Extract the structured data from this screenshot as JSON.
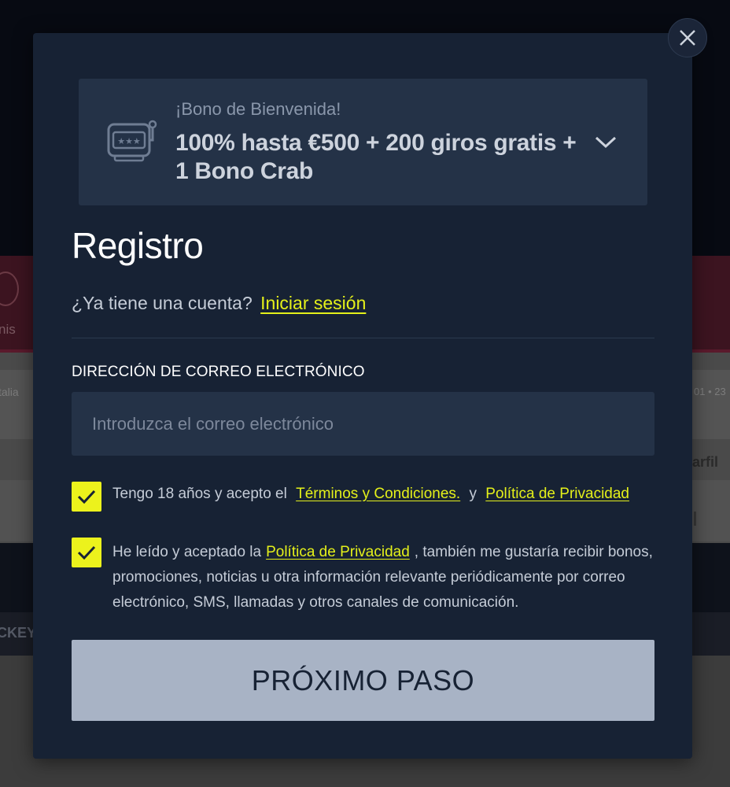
{
  "background": {
    "tennis_label": "nis",
    "league_label": "talia",
    "time_label": "01 • 23",
    "perfil_label": "arfil",
    "hockey_label": "CKEY"
  },
  "modal": {
    "bonus": {
      "subtitle": "¡Bono de Bienvenida!",
      "headline": "100% hasta €500 + 200 giros gratis + 1 Bono Crab",
      "icon": "slot-machine-icon",
      "expand_icon": "chevron-down-icon"
    },
    "title": "Registro",
    "login_prompt": "¿Ya tiene una cuenta?",
    "login_link": "Iniciar sesión",
    "email": {
      "label": "DIRECCIÓN DE CORREO ELECTRÓNICO",
      "placeholder": "Introduzca el correo electrónico",
      "value": ""
    },
    "consent_terms": {
      "checked": true,
      "text_before": "Tengo 18 años y acepto el",
      "link_terms": "Términos y Condiciones.",
      "text_and": "y",
      "link_privacy": "Política de Privacidad"
    },
    "consent_marketing": {
      "checked": true,
      "text_before": "He leído y aceptado la",
      "link_privacy": "Política de Privacidad",
      "text_after": ", también me gustaría recibir bonos, promociones, noticias u otra información relevante periódicamente por correo electrónico, SMS, llamadas y otros canales de comunicación."
    },
    "next_button": "PRÓXIMO PASO",
    "close_icon": "close-icon"
  },
  "colors": {
    "modal_bg": "#172234",
    "panel_bg": "#243247",
    "accent_yellow": "#e4f01a",
    "button_bg": "#a8b3c5"
  }
}
